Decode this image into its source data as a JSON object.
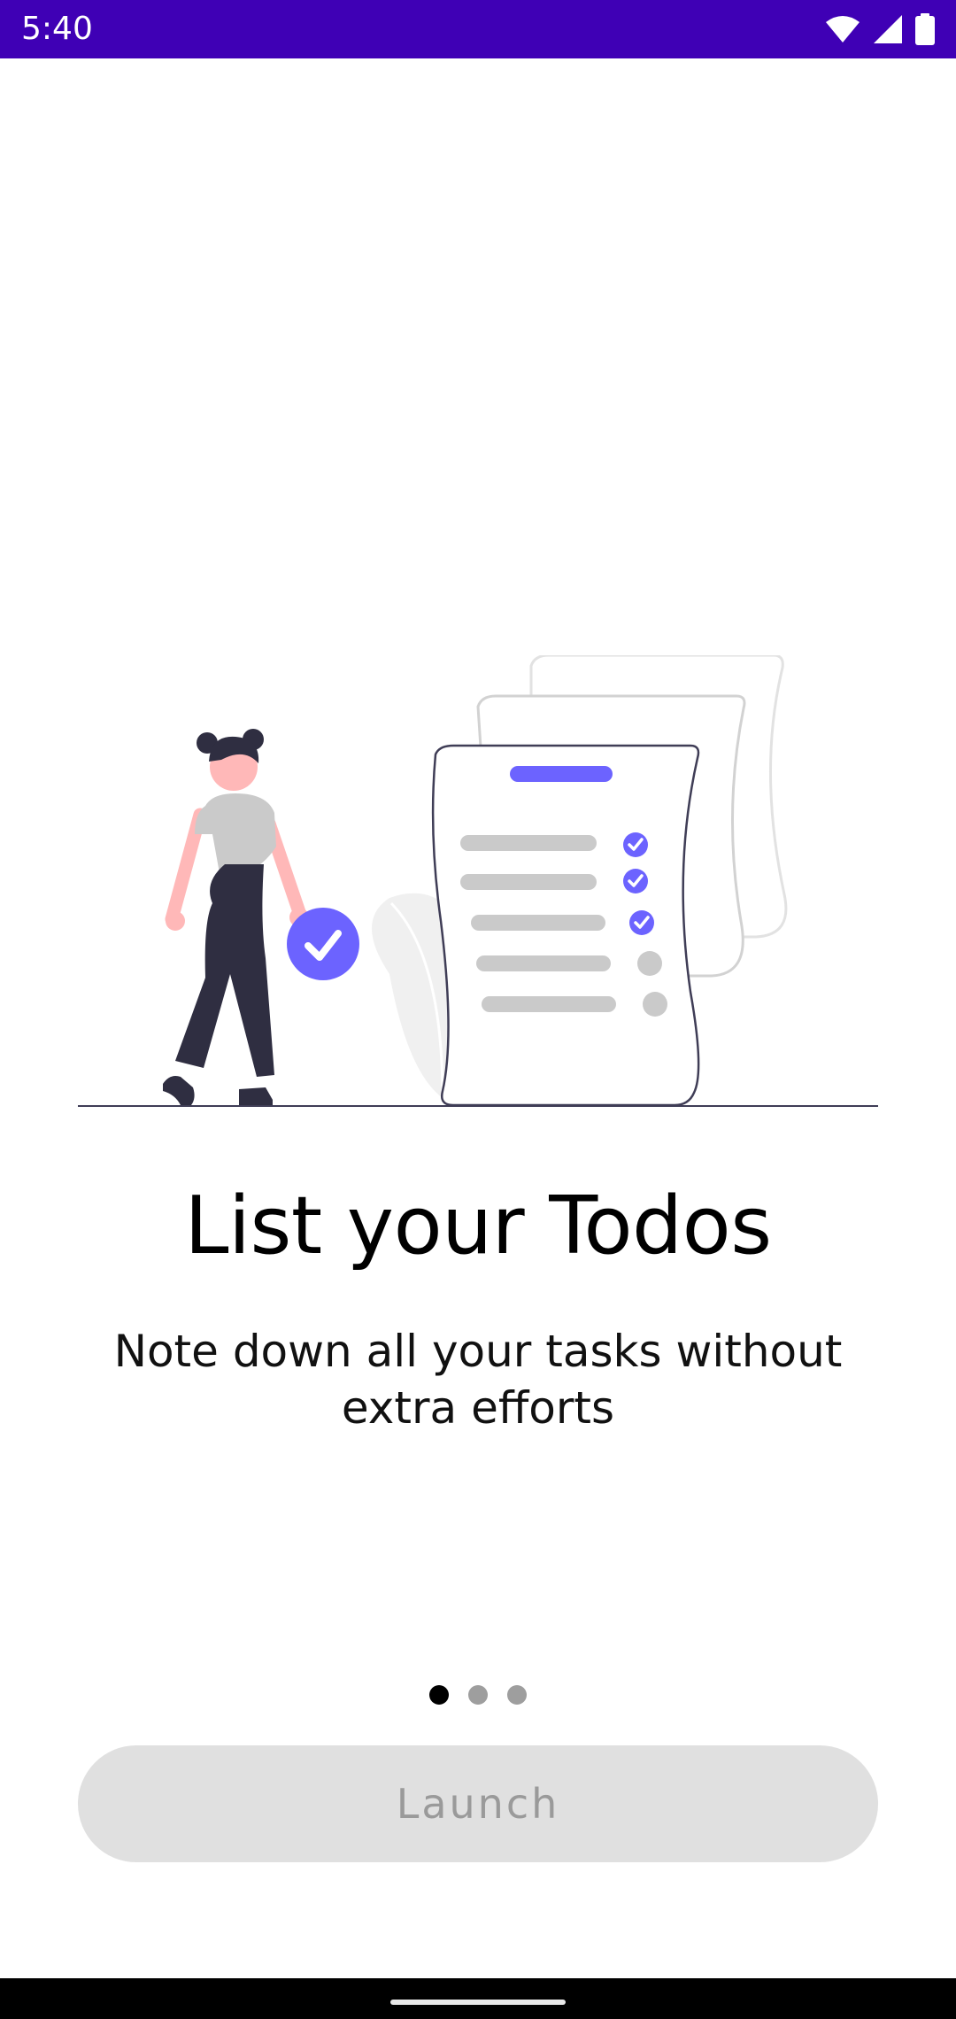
{
  "status_bar": {
    "time": "5:40",
    "background_color": "#3f00b5",
    "icons": [
      "wifi-icon",
      "cellular-signal-icon",
      "battery-icon"
    ]
  },
  "onboarding": {
    "illustration": "todo-list-illustration",
    "title": "List your Todos",
    "subtitle": "Note down all your tasks without extra efforts",
    "accent_color": "#6c63ff",
    "pager": {
      "current_page": 1,
      "total_pages": 3
    }
  },
  "launch_button": {
    "label": "Launch",
    "enabled": false
  }
}
